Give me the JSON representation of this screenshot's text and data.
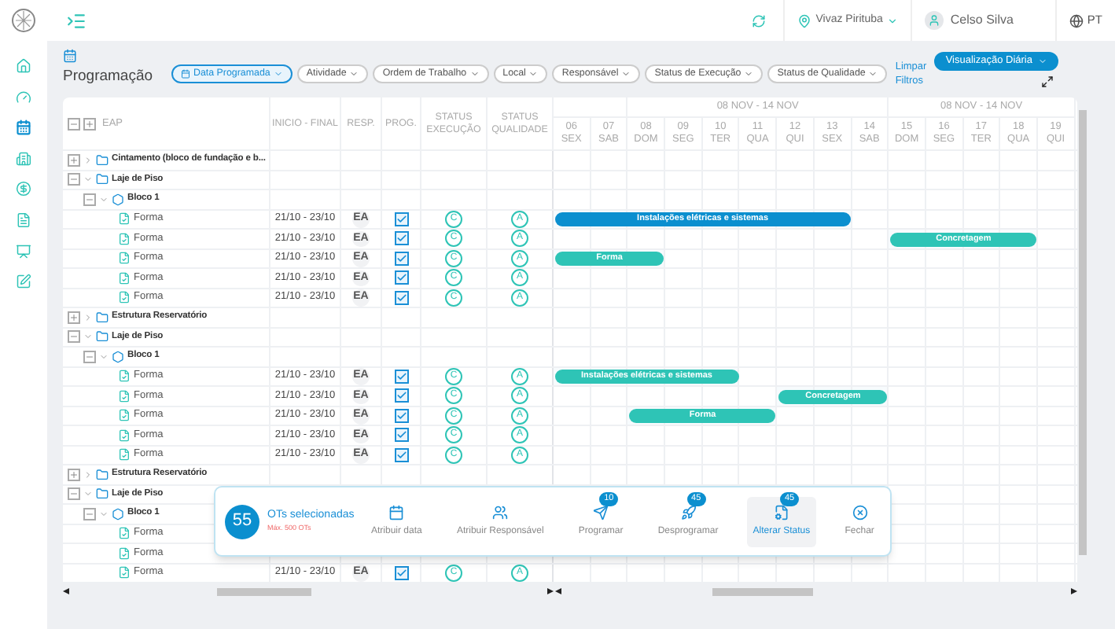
{
  "topbar": {
    "location": "Vivaz Pirituba",
    "user": "Celso Silva",
    "language": "PT"
  },
  "sidebar": {
    "items": [
      {
        "kind": "home",
        "selected": false
      },
      {
        "kind": "gauge",
        "selected": false
      },
      {
        "kind": "calendar",
        "selected": true
      },
      {
        "kind": "building",
        "selected": false
      },
      {
        "kind": "money",
        "selected": false
      },
      {
        "kind": "file",
        "selected": false
      },
      {
        "kind": "board",
        "selected": false
      },
      {
        "kind": "edit",
        "selected": false
      }
    ]
  },
  "page": {
    "title": "Programação",
    "clear_filters": "Limpar Filtros",
    "view_button": "Visualização Diária"
  },
  "filters": [
    {
      "label": "Data Programada",
      "selected": true
    },
    {
      "label": "Atividade",
      "selected": false
    },
    {
      "label": "Ordem de Trabalho",
      "selected": false
    },
    {
      "label": "Local",
      "selected": false
    },
    {
      "label": "Responsável",
      "selected": false
    },
    {
      "label": "Status de Execução",
      "selected": false
    },
    {
      "label": "Status de Qualidade",
      "selected": false
    }
  ],
  "table": {
    "columns": [
      "EAP",
      "INICIO - FINAL",
      "RESP.",
      "PROG.",
      "STATUS EXECUÇÃO",
      "STATUS QUALIDADE"
    ],
    "weeks": [
      {
        "days": [
          {
            "num": "06",
            "name": "SEX"
          },
          {
            "num": "07",
            "name": "SAB"
          }
        ]
      },
      {
        "label": "08 NOV - 14 NOV",
        "days": [
          {
            "num": "08",
            "name": "DOM"
          },
          {
            "num": "09",
            "name": "SEG"
          },
          {
            "num": "10",
            "name": "TER"
          },
          {
            "num": "11",
            "name": "QUA"
          },
          {
            "num": "12",
            "name": "QUI"
          },
          {
            "num": "13",
            "name": "SEX"
          },
          {
            "num": "14",
            "name": "SAB"
          }
        ]
      },
      {
        "label": "08 NOV - 14 NOV",
        "days": [
          {
            "num": "15",
            "name": "DOM"
          },
          {
            "num": "16",
            "name": "SEG"
          },
          {
            "num": "17",
            "name": "TER"
          },
          {
            "num": "18",
            "name": "QUA"
          },
          {
            "num": "19",
            "name": "QUI"
          }
        ]
      }
    ],
    "tree": [
      {
        "kind": "folder",
        "label": "Cintamento (bloco de fundação e b...",
        "expanded": false
      },
      {
        "kind": "folder",
        "label": "Laje de Piso",
        "expanded": true,
        "children": [
          {
            "kind": "block",
            "label": "Bloco 1",
            "expanded": true,
            "children": [
              {
                "kind": "task",
                "label": "Forma",
                "dates": "21/10 - 23/10",
                "resp": "EA",
                "prog": true,
                "execution": "C",
                "quality": "A",
                "bar": {
                  "label": "Instalações elétricas e sistemas",
                  "color": "#0b8fcf",
                  "days": [
                    true,
                    true,
                    true,
                    true,
                    true,
                    true,
                    true,
                    true,
                    false,
                    false,
                    false,
                    false,
                    false,
                    false
                  ]
                }
              },
              {
                "kind": "task",
                "label": "Forma",
                "dates": "21/10 - 23/10",
                "resp": "EA",
                "prog": true,
                "execution": "C",
                "quality": "A",
                "bar": {
                  "label": "Concretagem",
                  "color": "#2ec4b6",
                  "days": [
                    false,
                    false,
                    false,
                    false,
                    false,
                    false,
                    false,
                    false,
                    false,
                    true,
                    true,
                    true,
                    true,
                    false
                  ]
                }
              },
              {
                "kind": "task",
                "label": "Forma",
                "dates": "21/10 - 23/10",
                "resp": "EA",
                "prog": true,
                "execution": "C",
                "quality": "A",
                "bar": {
                  "label": "Forma",
                  "color": "#2ec4b6",
                  "days": [
                    true,
                    true,
                    true,
                    false,
                    false,
                    false,
                    false,
                    false,
                    false,
                    false,
                    false,
                    false,
                    false,
                    false
                  ]
                }
              },
              {
                "kind": "task",
                "label": "Forma",
                "dates": "21/10 - 23/10",
                "resp": "EA",
                "prog": true,
                "execution": "C",
                "quality": "A"
              },
              {
                "kind": "task",
                "label": "Forma",
                "dates": "21/10 - 23/10",
                "resp": "EA",
                "prog": true,
                "execution": "C",
                "quality": "A"
              }
            ]
          }
        ]
      },
      {
        "kind": "folder",
        "label": "Estrutura Reservatório",
        "expanded": false
      },
      {
        "kind": "folder",
        "label": "Laje de Piso",
        "expanded": true,
        "children": [
          {
            "kind": "block",
            "label": "Bloco 1",
            "expanded": true,
            "children": [
              {
                "kind": "task",
                "label": "Forma",
                "dates": "21/10 - 23/10",
                "resp": "EA",
                "prog": true,
                "execution": "C",
                "quality": "A",
                "bar": {
                  "label": "Instalações elétricas e sistemas",
                  "color": "#2ec4b6",
                  "days": [
                    true,
                    true,
                    true,
                    true,
                    true,
                    false,
                    false,
                    false,
                    false,
                    false,
                    false,
                    false,
                    false,
                    false
                  ]
                }
              },
              {
                "kind": "task",
                "label": "Forma",
                "dates": "21/10 - 23/10",
                "resp": "EA",
                "prog": true,
                "execution": "C",
                "quality": "A",
                "bar": {
                  "label": "Concretagem",
                  "color": "#2ec4b6",
                  "days": [
                    false,
                    false,
                    false,
                    false,
                    false,
                    false,
                    true,
                    true,
                    true,
                    false,
                    false,
                    false,
                    false,
                    false
                  ]
                }
              },
              {
                "kind": "task",
                "label": "Forma",
                "dates": "21/10 - 23/10",
                "resp": "EA",
                "prog": true,
                "execution": "C",
                "quality": "A",
                "bar": {
                  "label": "Forma",
                  "color": "#2ec4b6",
                  "days": [
                    false,
                    false,
                    true,
                    true,
                    true,
                    true,
                    false,
                    false,
                    false,
                    false,
                    false,
                    false,
                    false,
                    false
                  ]
                }
              },
              {
                "kind": "task",
                "label": "Forma",
                "dates": "21/10 - 23/10",
                "resp": "EA",
                "prog": true,
                "execution": "C",
                "quality": "A"
              },
              {
                "kind": "task",
                "label": "Forma",
                "dates": "21/10 - 23/10",
                "resp": "EA",
                "prog": true,
                "execution": "C",
                "quality": "A"
              }
            ]
          }
        ]
      },
      {
        "kind": "folder",
        "label": "Estrutura Reservatório",
        "expanded": false
      },
      {
        "kind": "folder",
        "label": "Laje de Piso",
        "expanded": true,
        "children": [
          {
            "kind": "block",
            "label": "Bloco 1",
            "expanded": true,
            "children": [
              {
                "kind": "task",
                "label": "Forma"
              },
              {
                "kind": "task",
                "label": "Forma"
              },
              {
                "kind": "task",
                "label": "Forma",
                "dates": "21/10 - 23/10",
                "resp": "EA",
                "prog": true,
                "execution": "C",
                "quality": "A"
              }
            ]
          }
        ]
      }
    ]
  },
  "selection_bar": {
    "count": "55",
    "title": "OTs selecionadas",
    "limit": "Máx. 500 OTs",
    "actions": [
      {
        "kind": "date",
        "label": "Atribuir data",
        "selected": false
      },
      {
        "kind": "assign",
        "label": "Atribuir Responsável",
        "selected": false
      },
      {
        "kind": "schedule",
        "label": "Programar",
        "badge": "10",
        "selected": false
      },
      {
        "kind": "unschedule",
        "label": "Desprogramar",
        "badge": "45",
        "selected": false
      },
      {
        "kind": "status",
        "label": "Alterar Status",
        "badge": "45",
        "selected": true
      },
      {
        "kind": "close",
        "label": "Fechar",
        "selected": false
      }
    ]
  }
}
